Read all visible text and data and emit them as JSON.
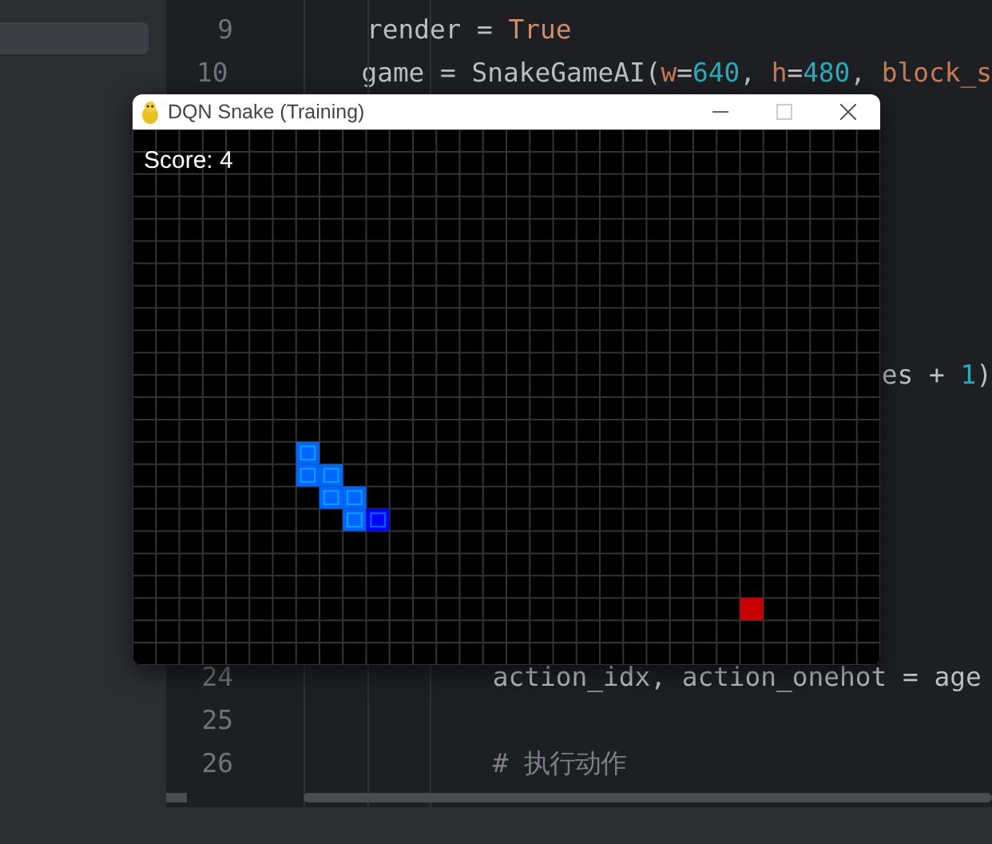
{
  "editor": {
    "lines": [
      {
        "kind": "numbered",
        "number": "9",
        "tokens": [
          {
            "kind": "plain",
            "text": "    render = "
          },
          {
            "kind": "keyword",
            "text": "True"
          }
        ]
      },
      {
        "kind": "numbered",
        "number": "10",
        "tokens": [
          {
            "kind": "plain",
            "text": "    game = SnakeGameAI("
          },
          {
            "kind": "param",
            "text": "w"
          },
          {
            "kind": "plain",
            "text": "="
          },
          {
            "kind": "number",
            "text": "640"
          },
          {
            "kind": "plain",
            "text": ", "
          },
          {
            "kind": "param",
            "text": "h"
          },
          {
            "kind": "plain",
            "text": "="
          },
          {
            "kind": "number",
            "text": "480"
          },
          {
            "kind": "plain",
            "text": ", "
          },
          {
            "kind": "param",
            "text": "block_s"
          }
        ]
      },
      {
        "kind": "fragment",
        "tokens": [
          {
            "kind": "plain",
            "text": "es + "
          },
          {
            "kind": "number",
            "text": "1"
          },
          {
            "kind": "plain",
            "text": ")"
          }
        ]
      },
      {
        "kind": "numbered",
        "number": "24",
        "tokens": [
          {
            "kind": "plain",
            "text": "            action_idx, action_onehot = age"
          }
        ]
      },
      {
        "kind": "numbered",
        "number": "25"
      },
      {
        "kind": "numbered",
        "number": "26",
        "tokens": [
          {
            "kind": "comment",
            "text": "            # 执行动作"
          }
        ]
      }
    ]
  },
  "game_window": {
    "title": "DQN Snake (Training)",
    "score": "Score: 4"
  }
}
